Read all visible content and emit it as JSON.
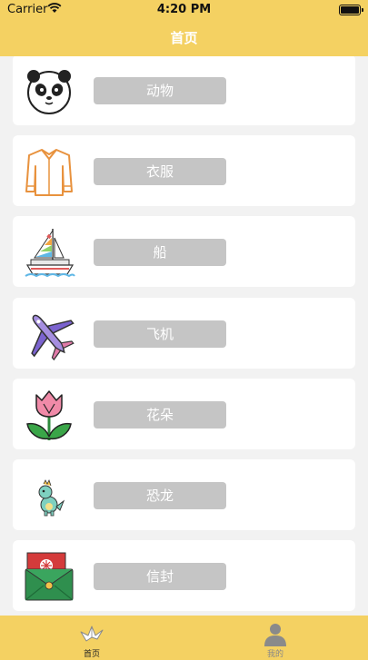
{
  "status": {
    "carrier": "Carrier",
    "time": "4:20 PM"
  },
  "nav": {
    "title": "首页"
  },
  "items": [
    {
      "label": "动物",
      "icon": "panda-icon"
    },
    {
      "label": "衣服",
      "icon": "shirt-icon"
    },
    {
      "label": "船",
      "icon": "sailboat-icon"
    },
    {
      "label": "飞机",
      "icon": "airplane-icon"
    },
    {
      "label": "花朵",
      "icon": "tulip-icon"
    },
    {
      "label": "恐龙",
      "icon": "dinosaur-icon"
    },
    {
      "label": "信封",
      "icon": "envelope-icon"
    }
  ],
  "tabs": [
    {
      "label": "首页",
      "icon": "paper-crane-icon"
    },
    {
      "label": "我的",
      "icon": "profile-icon"
    }
  ],
  "colors": {
    "header": "#f4d162",
    "button": "#c5c5c5",
    "background": "#f2f2f2"
  }
}
